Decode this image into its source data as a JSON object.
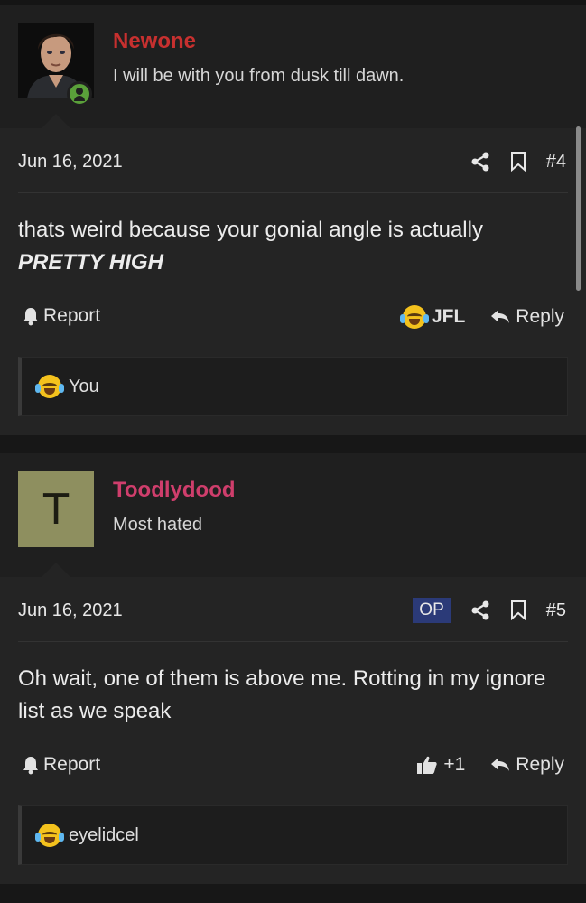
{
  "posts": [
    {
      "username": "Newone",
      "username_color": "#c7302f",
      "user_title": "I will be with you from dusk till dawn.",
      "avatar_type": "photo",
      "online": true,
      "date": "Jun 16, 2021",
      "post_number": "#4",
      "is_op": false,
      "message_line1": "thats weird because your gonial angle is actually",
      "message_emphasis": "PRETTY HIGH",
      "report_label": "Report",
      "reaction_label": "JFL",
      "reply_label": "Reply",
      "reactions_summary": "You",
      "icons": [
        "share-icon",
        "bookmark-icon",
        "bell-icon",
        "laughing-crying-emoji",
        "reply-arrow-icon"
      ]
    },
    {
      "username": "Toodlydood",
      "username_color": "#cf3e6c",
      "user_title": "Most hated",
      "avatar_letter": "T",
      "avatar_color": "#8e8f5f",
      "online": false,
      "date": "Jun 16, 2021",
      "op_badge": "OP",
      "post_number": "#5",
      "is_op": true,
      "message": "Oh wait, one of them is above me. Rotting in my ignore list as we speak",
      "report_label": "Report",
      "like_label": "+1",
      "reply_label": "Reply",
      "reactions_summary": "eyelidcel",
      "icons": [
        "share-icon",
        "bookmark-icon",
        "bell-icon",
        "thumbs-up-icon",
        "reply-arrow-icon"
      ]
    }
  ]
}
